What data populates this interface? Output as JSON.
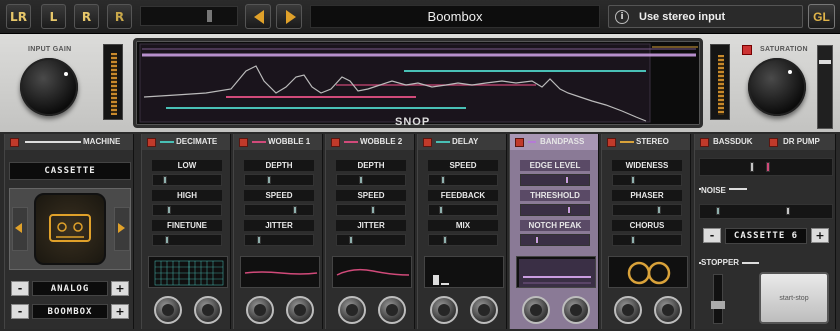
{
  "toolbar": {
    "channel_buttons": [
      "LR",
      "L",
      "R",
      "R"
    ],
    "preset_name": "Boombox",
    "info_glyph": "i",
    "stereo_hint": "Use stereo input",
    "gl_label": "GL"
  },
  "upper": {
    "input_gain_label": "INPUT GAIN",
    "saturation_label": "SATURATION",
    "display_brand": "SNOP"
  },
  "machine": {
    "title": "MACHINE",
    "tape_type": "CASSETTE",
    "mode": "ANALOG",
    "preset": "BOOMBOX",
    "minus": "-",
    "plus": "+",
    "icon": "cassette-icon"
  },
  "modules": [
    {
      "title": "DECIMATE",
      "accent": "#49c0b6",
      "params": [
        "LOW",
        "HIGH",
        "FINETUNE"
      ]
    },
    {
      "title": "WOBBLE 1",
      "accent": "#d14a7a",
      "params": [
        "DEPTH",
        "SPEED",
        "JITTER"
      ]
    },
    {
      "title": "WOBBLE 2",
      "accent": "#d14a7a",
      "params": [
        "DEPTH",
        "SPEED",
        "JITTER"
      ]
    },
    {
      "title": "DELAY",
      "accent": "#49c0b6",
      "params": [
        "SPEED",
        "FEEDBACK",
        "MIX"
      ]
    },
    {
      "title": "BANDPASS",
      "accent": "#b57ad6",
      "params": [
        "EDGE LEVEL",
        "THRESHOLD",
        "NOTCH PEAK"
      ]
    },
    {
      "title": "STEREO",
      "accent": "#d9a23a",
      "params": [
        "WIDENESS",
        "PHASER",
        "CHORUS"
      ]
    }
  ],
  "right": {
    "bassduk": "BASSDUK",
    "dr_pump": "DR PUMP",
    "noise_label": "NOISE",
    "noise_value": "CASSETTE 6",
    "minus": "-",
    "plus": "+",
    "stopper_label": "STOPPER",
    "start_stop": "start-stop"
  },
  "colors": {
    "accent_orange": "#e0a12a",
    "led_red": "#c13a2a",
    "teal": "#49c0b6",
    "pink": "#d14a7a",
    "purple": "#b57ad6"
  }
}
